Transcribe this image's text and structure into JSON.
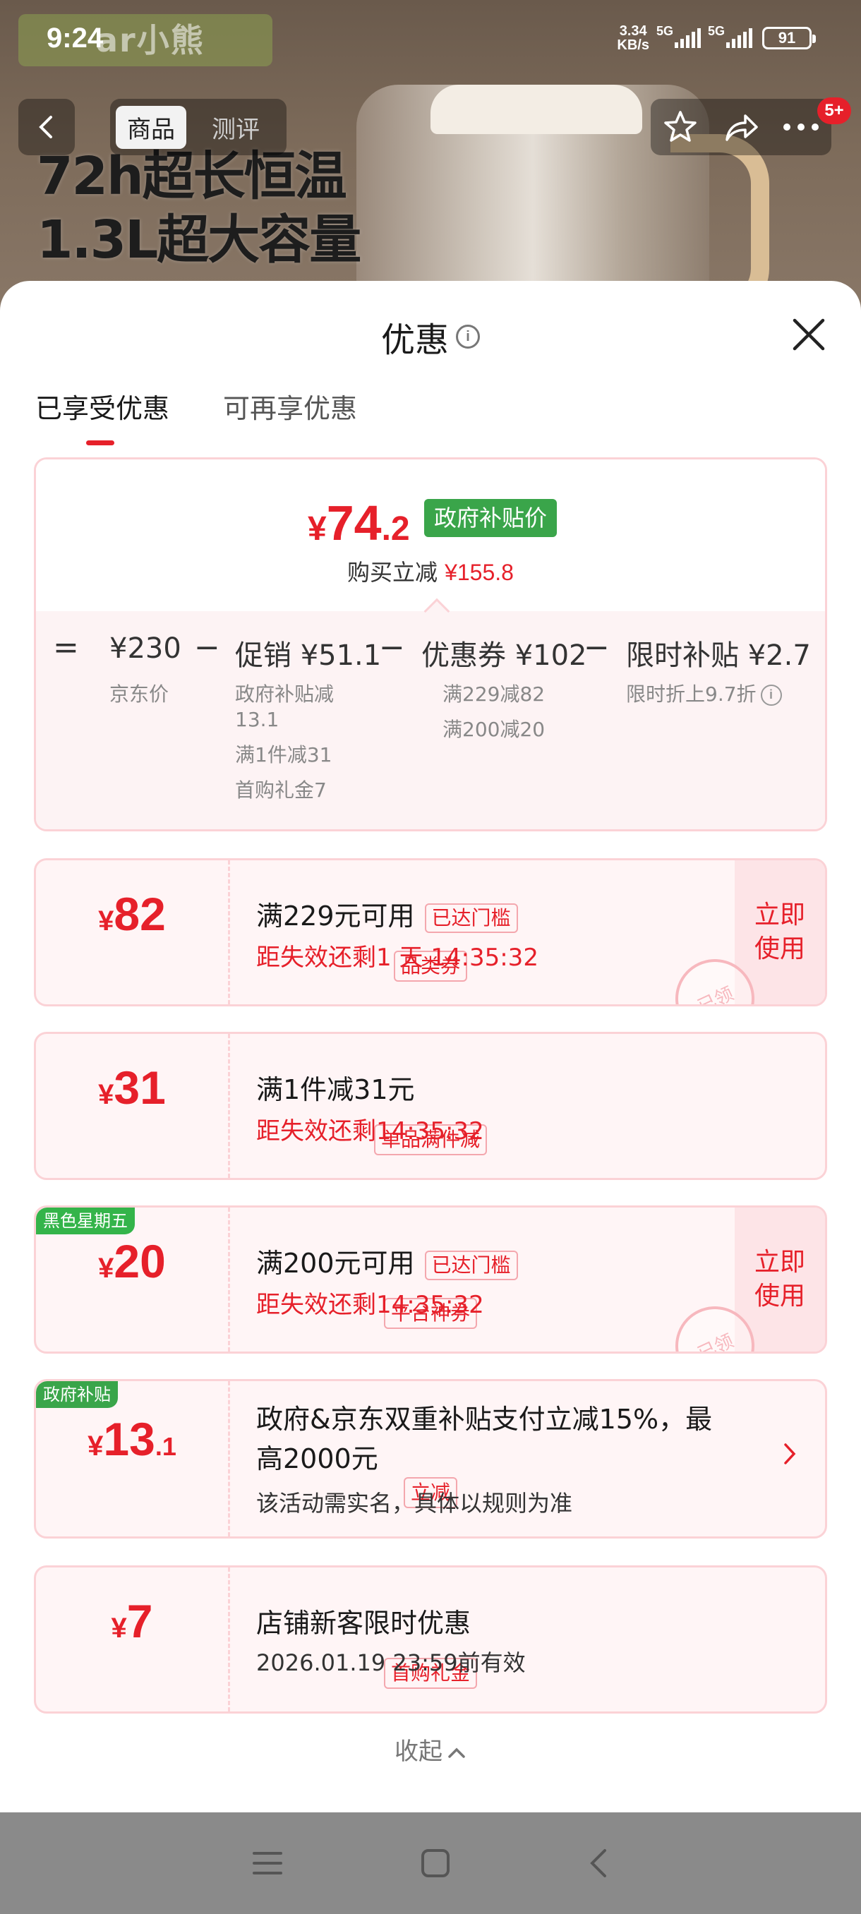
{
  "status_bar": {
    "time": "9:24",
    "net_speed_value": "3.34",
    "net_speed_unit": "KB/s",
    "signal1_label": "5G",
    "signal2_label": "5G",
    "battery": "91"
  },
  "background": {
    "brand_logo": "ar小熊",
    "promo_line1": "72h超长恒温",
    "promo_line2": "1.3L超大容量",
    "nav_tabs": [
      "商品",
      "测评"
    ],
    "notification_badge": "5+"
  },
  "sheet": {
    "title": "优惠",
    "info_glyph": "i",
    "tabs": [
      "已享受优惠",
      "可再享优惠"
    ],
    "summary": {
      "final_price_currency": "¥",
      "final_price_int": "74",
      "final_price_dec": ".2",
      "gov_price_tag": "政府补贴价",
      "reduce_label": "购买立减",
      "reduce_amount": "¥155.8",
      "equals": "=",
      "minus": "−",
      "jd_price": "¥230",
      "jd_price_label": "京东价",
      "promo_label": "促销 ¥51.1",
      "promo_items": [
        "政府补贴减",
        "13.1",
        "满1件减31",
        "首购礼金7"
      ],
      "coupon_label": "优惠券 ¥102",
      "coupon_items": [
        "满229减82",
        "满200减20"
      ],
      "flash_label": "限时补贴 ¥2.7",
      "flash_item": "限时折上9.7折"
    },
    "coupons": [
      {
        "currency": "¥",
        "amount": "82",
        "type": "品类券",
        "title": "满229元可用",
        "tag": "已达门槛",
        "countdown": "距失效还剩1 天 14:35:32",
        "action": [
          "立即",
          "使用"
        ],
        "stamp": "已领"
      },
      {
        "currency": "¥",
        "amount": "31",
        "type": "单品满件减",
        "title": "满1件减31元",
        "countdown": "距失效还剩14:35:32"
      },
      {
        "corner": "黑色星期五",
        "currency": "¥",
        "amount": "20",
        "type": "平台神券",
        "title": "满200元可用",
        "tag": "已达门槛",
        "countdown": "距失效还剩14:35:32",
        "action": [
          "立即",
          "使用"
        ],
        "stamp": "已领"
      },
      {
        "corner": "政府补贴",
        "currency": "¥",
        "amount": "13",
        "amount_dec": ".1",
        "type": "立减",
        "desc_line1": "政府&京东双重补贴支付立减15%，最",
        "desc_line2": "高2000元",
        "note": "该活动需实名，具体以规则为准"
      },
      {
        "currency": "¥",
        "amount": "7",
        "type": "首购礼金",
        "title": "店铺新客限时优惠",
        "note": "2026.01.19 23:59前有效"
      }
    ],
    "collapse_label": "收起"
  },
  "colors": {
    "accent_red": "#e6202a",
    "gov_green": "#3aa54a",
    "black_friday_green": "#34b44a",
    "card_border": "#fbd2d6"
  },
  "icons": [
    "back-icon",
    "star-icon",
    "share-icon",
    "more-icon",
    "info-icon",
    "close-icon",
    "chevron-right-icon",
    "chevron-up-icon",
    "menu-icon",
    "home-icon",
    "back-nav-icon"
  ]
}
